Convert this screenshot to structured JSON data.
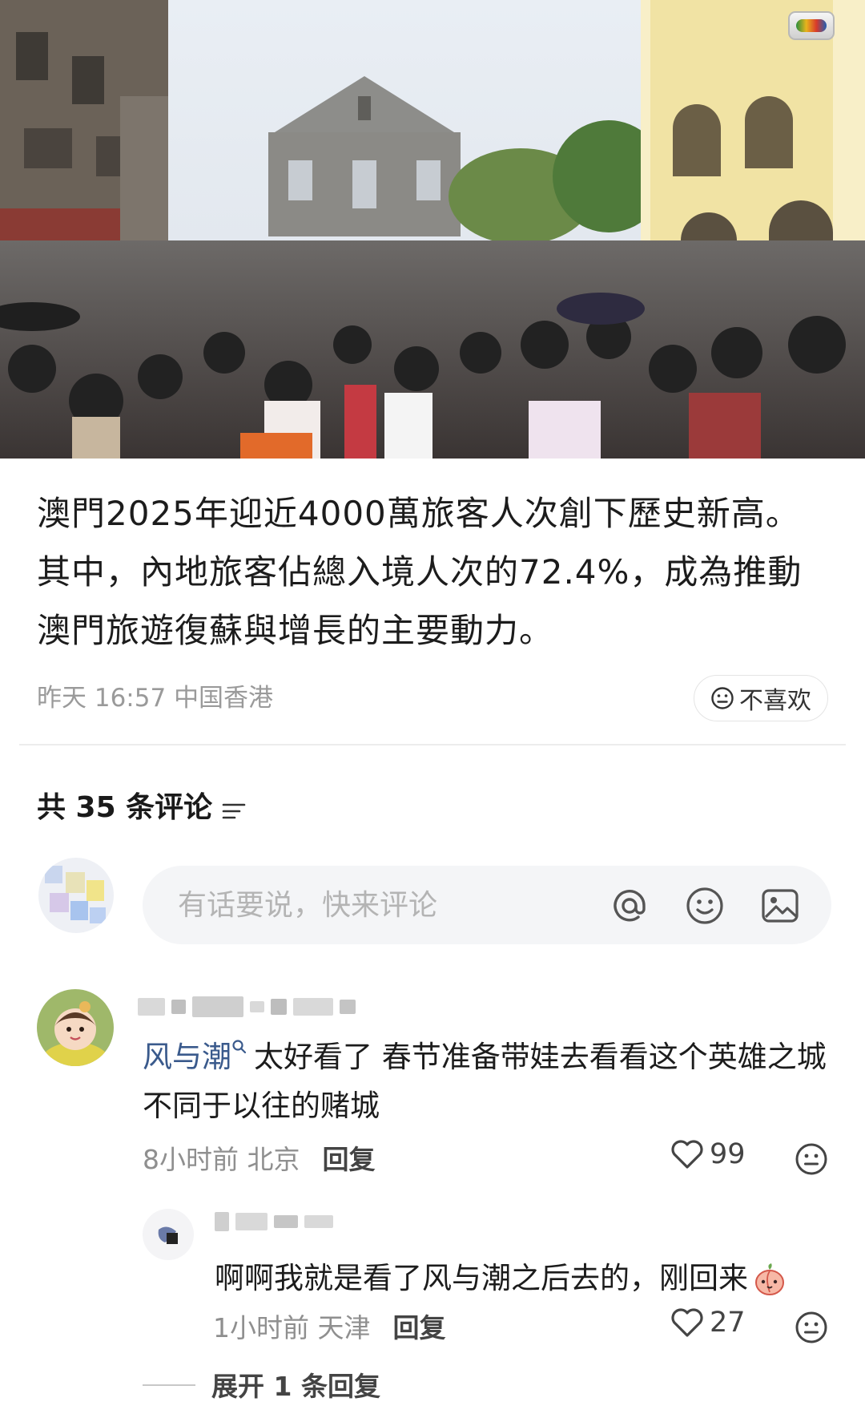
{
  "post": {
    "image_alt": "Crowd of tourists in front of the Ruins of St. Paul's, Macau",
    "body": "澳門2025年迎近4000萬旅客人次創下歷史新高。其中，內地旅客佔總入境人次的72.4%，成為推動澳門旅遊復蘇與增長的主要動力。",
    "time": "昨天 16:57",
    "location": "中国香港",
    "dislike_label": "不喜欢"
  },
  "comments_section": {
    "title": "共 35 条评论",
    "composer_placeholder": "有话要说，快来评论"
  },
  "comments": [
    {
      "mention": "风与潮",
      "text": "太好看了 春节准备带娃去看看这个英雄之城 不同于以往的赌城",
      "time": "8小时前",
      "location": "北京",
      "reply_label": "回复",
      "likes": "99"
    }
  ],
  "reply": {
    "text": "啊啊我就是看了风与潮之后去的，刚回来",
    "time": "1小时前",
    "location": "天津",
    "reply_label": "回复",
    "likes": "27"
  },
  "expand_label": "展开 1 条回复",
  "colors": {
    "mention": "#3a5a8c",
    "meta": "#9a9a9a",
    "composer_bg": "#f4f5f7"
  },
  "icons": [
    "sort-icon",
    "at-icon",
    "emoji-icon",
    "image-icon",
    "heart-icon",
    "dislike-face-icon"
  ]
}
